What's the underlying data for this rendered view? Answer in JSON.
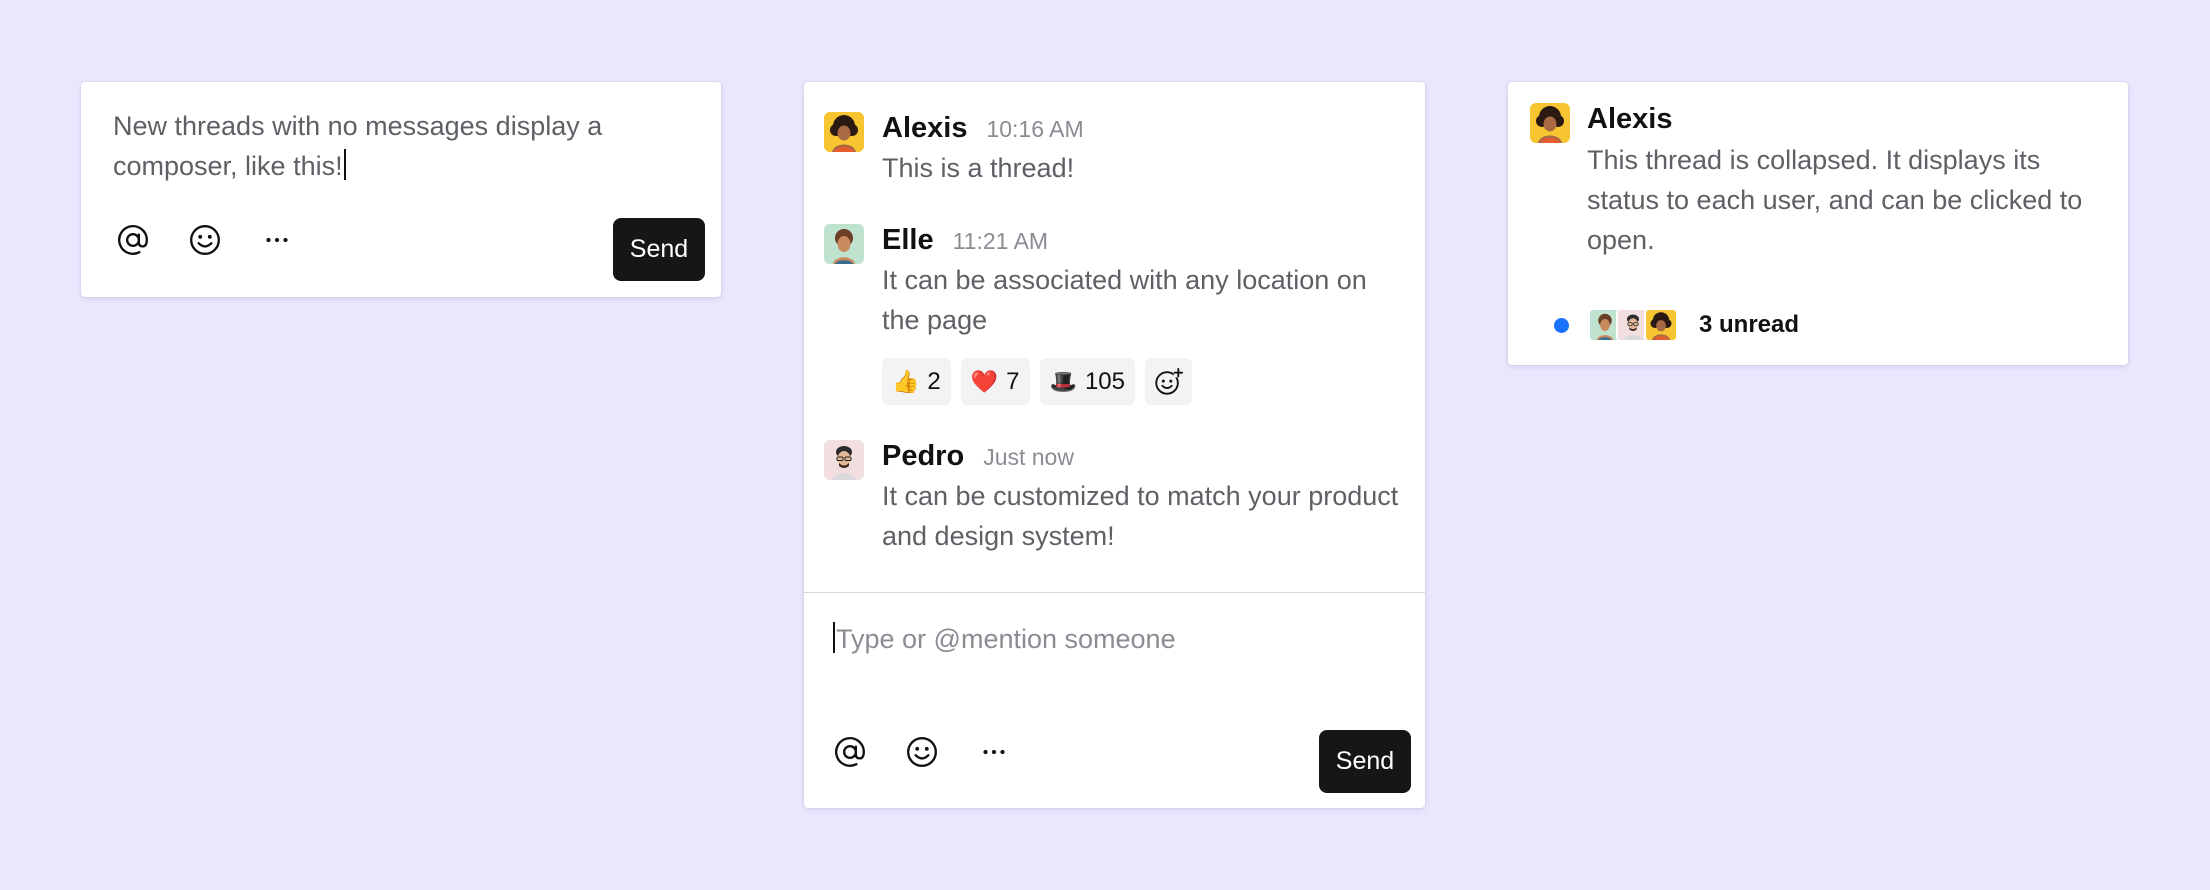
{
  "composer_card": {
    "text": "New threads with no messages display a composer, like this!",
    "send_label": "Send"
  },
  "thread_card": {
    "messages": [
      {
        "author": "Alexis",
        "time": "10:16 AM",
        "text": "This is a thread!",
        "avatar": "alexis-avatar"
      },
      {
        "author": "Elle",
        "time": "11:21 AM",
        "text": "It can be associated with any location on the page",
        "avatar": "elle-avatar",
        "reactions": [
          {
            "emoji": "👍",
            "count": "2",
            "icon": "thumbs-up-icon"
          },
          {
            "emoji": "❤️",
            "count": "7",
            "icon": "heart-icon"
          },
          {
            "emoji": "🎩",
            "count": "105",
            "icon": "top-hat-icon"
          }
        ]
      },
      {
        "author": "Pedro",
        "time": "Just now",
        "text": "It can be customized to match your product and design system!",
        "avatar": "pedro-avatar"
      }
    ],
    "input_placeholder": "Type or @mention someone",
    "send_label": "Send"
  },
  "collapsed_card": {
    "author": "Alexis",
    "text": "This thread is collapsed. It displays its status to each user, and can be clicked to open.",
    "unread_label": "3 unread"
  },
  "colors": {
    "background": "#e9e7fd",
    "send_button": "#161616",
    "unread_dot": "#1a73ff",
    "alexis_avatar_bg": "#f7c531",
    "elle_avatar_bg": "#bfe3cf",
    "pedro_avatar_bg": "#f2dede"
  }
}
